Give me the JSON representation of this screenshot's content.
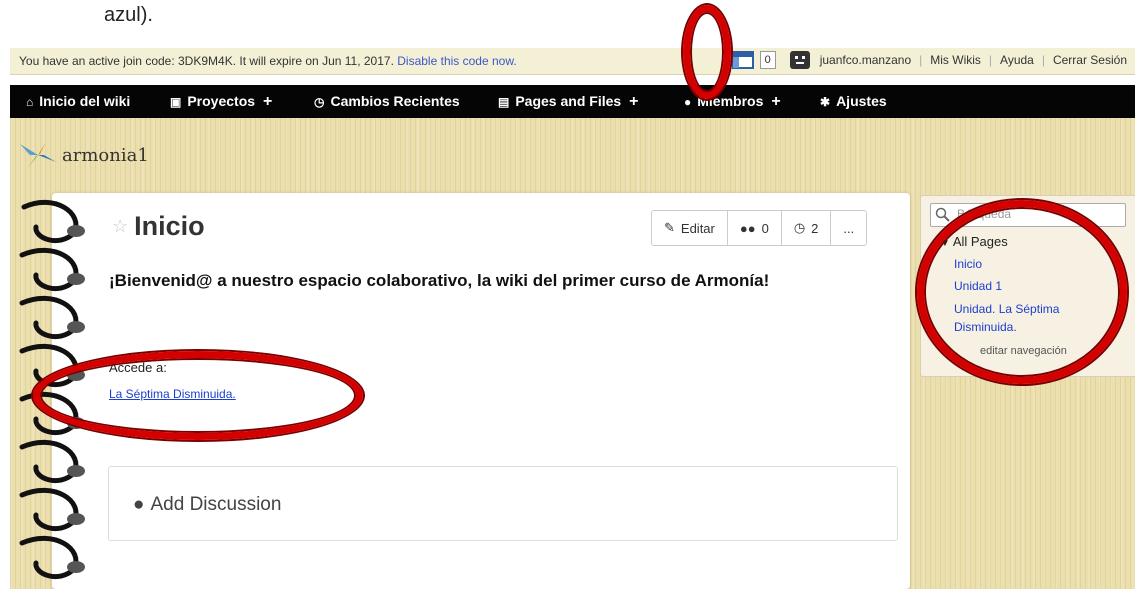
{
  "caption": "azul).",
  "topbar": {
    "message_prefix": "You have an active join code: 3DK9M4K. It will expire on Jun 11, 2017.",
    "disable_link": "Disable this code now.",
    "notification_count": "0",
    "username": "juanfco.manzano",
    "links": [
      "Mis Wikis",
      "Ayuda",
      "Cerrar Sesión"
    ]
  },
  "nav": {
    "items": [
      {
        "label": "Inicio del wiki",
        "icon": "home-icon"
      },
      {
        "label": "Proyectos",
        "icon": "sitemap-icon",
        "plus": "+"
      },
      {
        "label": "Cambios Recientes",
        "icon": "clock-icon"
      },
      {
        "label": "Pages and Files",
        "icon": "file-icon",
        "plus": "+"
      },
      {
        "label": "Miembros",
        "icon": "user-icon",
        "plus": "+"
      },
      {
        "label": "Ajustes",
        "icon": "gear-icon"
      }
    ]
  },
  "wiki": {
    "name": "armonia1"
  },
  "page": {
    "title": "Inicio",
    "actions": {
      "edit": "Editar",
      "comments": "0",
      "history": "2",
      "more": "..."
    },
    "welcome": "¡Bienvenid@ a nuestro espacio colaborativo, la wiki del primer curso de Armonía!",
    "accede": "Accede a:",
    "link": "La Séptima Disminuida.",
    "discussion": "Add Discussion"
  },
  "sidebar": {
    "search_placeholder": "Búsqueda",
    "section": "All Pages",
    "pages": [
      "Inicio",
      "Unidad 1",
      "Unidad. La Séptima",
      "Disminuida."
    ],
    "edit_nav": "editar navegación"
  },
  "colors": {
    "accent_link": "#1a3fd0",
    "nav_bg": "#050505",
    "annotation": "#d40000"
  }
}
